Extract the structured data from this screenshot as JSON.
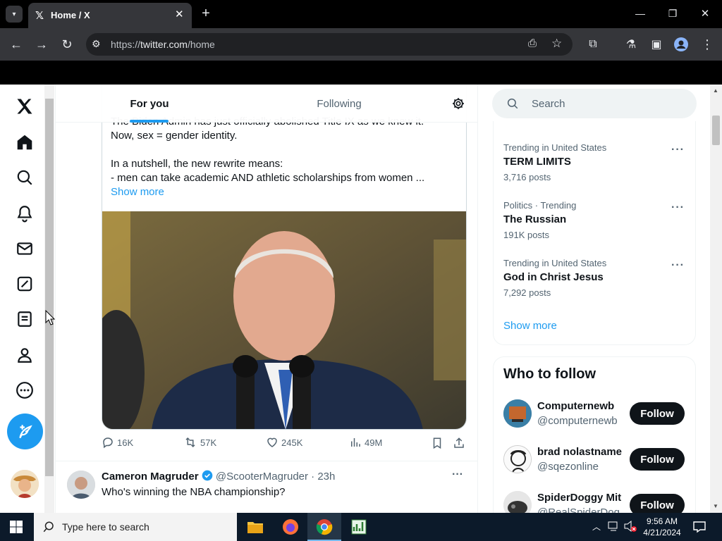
{
  "browser": {
    "tab_title": "Home / X",
    "url_prefix": "https://",
    "url_domain": "twitter.com",
    "url_path": "/home"
  },
  "header": {
    "tab_for_you": "For you",
    "tab_following": "Following"
  },
  "tweet": {
    "line0": "The Biden Admin has just officially abolished Title IX as we knew it.",
    "line1": "Now, sex = gender identity.",
    "line2": "In a nutshell, the new rewrite means:",
    "line3": "- men can take academic AND athletic scholarships from women ...",
    "show_more": "Show more",
    "replies": "16K",
    "reposts": "57K",
    "likes": "245K",
    "views": "49M"
  },
  "next_tweet": {
    "name": "Cameron Magruder",
    "handle": "@ScooterMagruder",
    "time": "· 23h",
    "text": "Who's winning the NBA championship?"
  },
  "search": {
    "placeholder": "Search"
  },
  "trends": {
    "items": [
      {
        "meta": "Trending in United States",
        "title": "TERM LIMITS",
        "posts": "3,716 posts"
      },
      {
        "meta": "Politics · Trending",
        "title": "The Russian",
        "posts": "191K posts"
      },
      {
        "meta": "Trending in United States",
        "title": "God in Christ Jesus",
        "posts": "7,292 posts"
      }
    ],
    "show_more": "Show more"
  },
  "who_to_follow": {
    "heading": "Who to follow",
    "follow_label": "Follow",
    "items": [
      {
        "name": "Computernewb",
        "handle": "@computernewb"
      },
      {
        "name": "brad nolastname",
        "handle": "@sqezonline"
      },
      {
        "name": "SpiderDoggy Mit",
        "handle": "@RealSpiderDog"
      }
    ]
  },
  "taskbar": {
    "search_placeholder": "Type here to search",
    "time": "9:56 AM",
    "date": "4/21/2024"
  },
  "colors": {
    "accent": "#1d9bf0",
    "text_primary": "#0f1419",
    "text_secondary": "#536471"
  }
}
